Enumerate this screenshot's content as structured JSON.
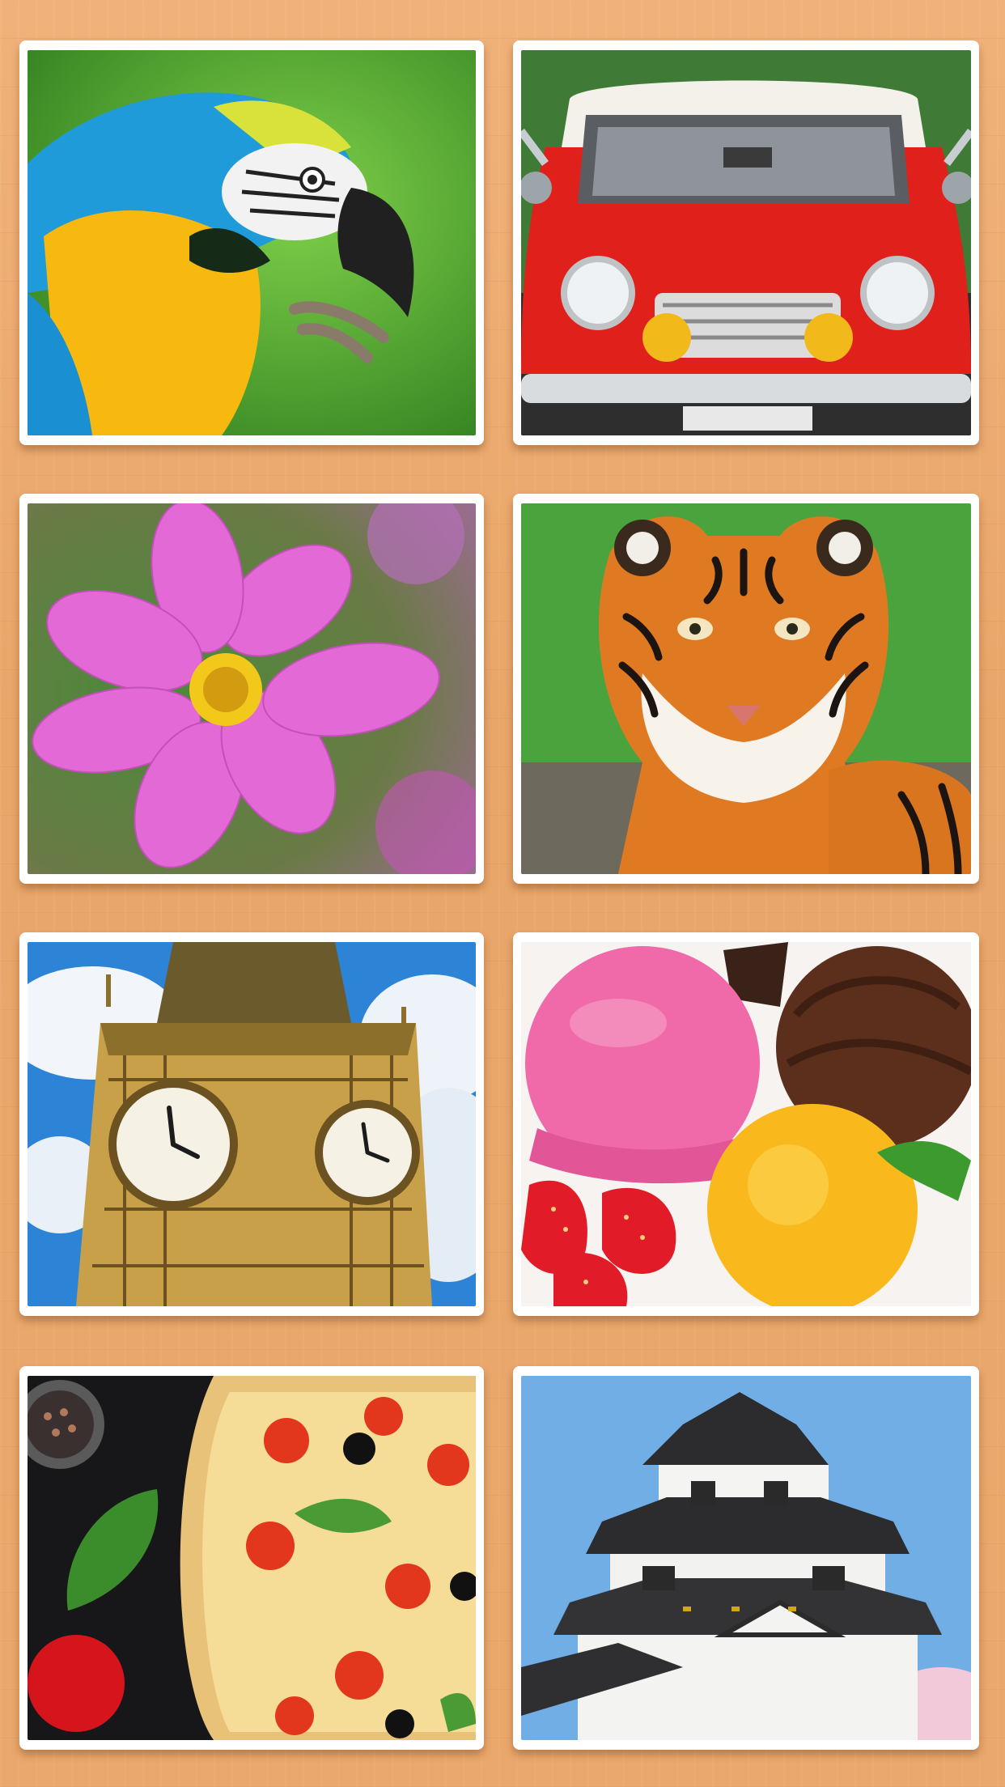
{
  "screen": {
    "background_color": "#eaa86c"
  },
  "puzzles": [
    {
      "id": "parrot",
      "subject": "Blue-and-yellow macaw parrot",
      "icon": "parrot-photo"
    },
    {
      "id": "car",
      "subject": "Red classic car",
      "icon": "car-photo"
    },
    {
      "id": "flower",
      "subject": "Pink cosmos flower",
      "icon": "flower-photo"
    },
    {
      "id": "tiger",
      "subject": "Bengal tiger",
      "icon": "tiger-photo"
    },
    {
      "id": "clock-tower",
      "subject": "Clock tower against blue sky",
      "icon": "clock-tower-photo"
    },
    {
      "id": "ice-cream",
      "subject": "Ice cream scoops with strawberries",
      "icon": "ice-cream-photo"
    },
    {
      "id": "pizza",
      "subject": "Pizza with tomatoes, olives and basil",
      "icon": "pizza-photo"
    },
    {
      "id": "castle",
      "subject": "Japanese castle",
      "icon": "castle-photo"
    }
  ]
}
